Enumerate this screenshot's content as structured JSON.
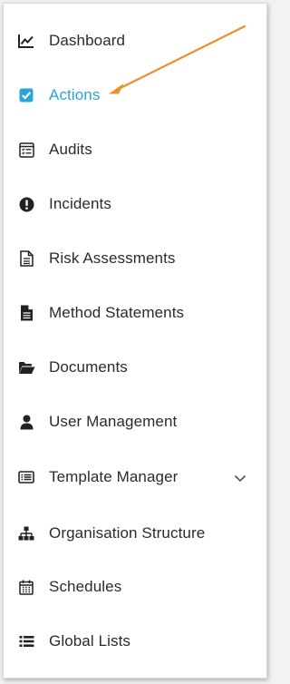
{
  "nav": {
    "items": [
      {
        "label": "Dashboard",
        "icon": "chart-line-icon"
      },
      {
        "label": "Actions",
        "icon": "checkbox-checked-icon",
        "active": true
      },
      {
        "label": "Audits",
        "icon": "checklist-icon"
      },
      {
        "label": "Incidents",
        "icon": "exclamation-circle-icon"
      },
      {
        "label": "Risk Assessments",
        "icon": "document-outline-icon"
      },
      {
        "label": "Method Statements",
        "icon": "document-solid-icon"
      },
      {
        "label": "Documents",
        "icon": "folder-open-icon"
      },
      {
        "label": "User Management",
        "icon": "user-icon"
      },
      {
        "label": "Template Manager",
        "icon": "list-card-icon",
        "expandable": true
      },
      {
        "label": "Organisation Structure",
        "icon": "sitemap-icon"
      },
      {
        "label": "Schedules",
        "icon": "calendar-icon"
      },
      {
        "label": "Global Lists",
        "icon": "list-icon"
      }
    ]
  },
  "colors": {
    "active": "#2ba4dc",
    "text": "#2b2b2b",
    "icon": "#222222",
    "annotation_arrow": "#f08c2a"
  }
}
